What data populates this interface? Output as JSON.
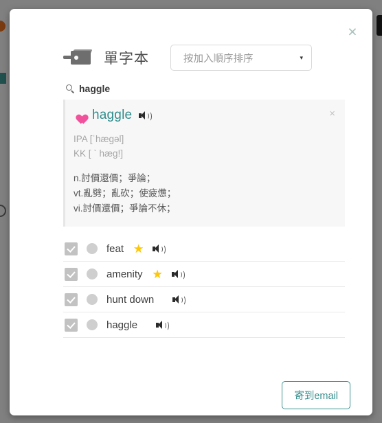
{
  "modal": {
    "close_label": "×",
    "panel_title": "單字本",
    "notebook_icon": "notebook-icon",
    "sort_select": {
      "value": "按加入順序排序",
      "caret": "▾"
    },
    "search": {
      "icon": "search-icon",
      "term": "haggle"
    },
    "word_card": {
      "favorite_icon": "heart-icon",
      "word": "haggle",
      "speaker_icon": "speaker-icon",
      "dismiss_label": "×",
      "phonetics": [
        "IPA [ˈhæɡəl]",
        "KK [ ˋ hæg!]"
      ],
      "definitions": [
        "n.討價還價；爭論；",
        "vt.亂劈；亂砍；使疲憊；",
        "vi.討價還價；爭論不休；"
      ]
    },
    "word_list": [
      {
        "word": "feat",
        "checked": true,
        "starred": true,
        "star_glyph": "★"
      },
      {
        "word": "amenity",
        "checked": true,
        "starred": true,
        "star_glyph": "★"
      },
      {
        "word": "hunt down",
        "checked": true,
        "starred": false,
        "star_glyph": ""
      },
      {
        "word": "haggle",
        "checked": true,
        "starred": false,
        "star_glyph": ""
      }
    ],
    "footer": {
      "email_button": "寄到email"
    }
  },
  "colors": {
    "accent_teal": "#3a9190",
    "word_teal": "#2f8c8c",
    "heart_pink": "#f0529c",
    "star_gold": "#fdc70b",
    "page_gray": "#808080",
    "card_bg": "#f7f7f7"
  }
}
